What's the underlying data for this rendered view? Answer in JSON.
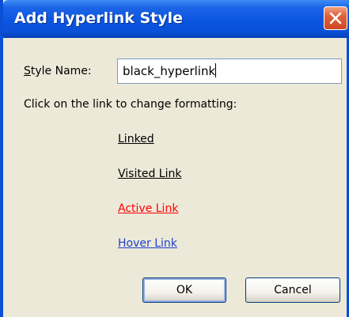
{
  "window": {
    "title": "Add Hyperlink Style"
  },
  "form": {
    "style_name_label_prefix": "S",
    "style_name_label_rest": "tyle Name:",
    "style_name_value": "black_hyperlink",
    "instruction": "Click on the link to change formatting:"
  },
  "links": {
    "linked": "Linked",
    "visited": "Visited Link",
    "active": "Active Link",
    "hover": "Hover Link"
  },
  "buttons": {
    "ok": "OK",
    "cancel": "Cancel"
  },
  "colors": {
    "titlebar": "#0a4fd6",
    "dialog_bg": "#ece9d8",
    "link_default": "#000000",
    "link_active": "#ff0000",
    "link_hover": "#1f3fd1"
  }
}
